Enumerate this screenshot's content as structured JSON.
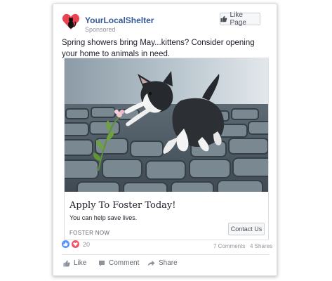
{
  "post": {
    "page_name": "YourLocalShelter",
    "sponsored_label": "Sponsored",
    "like_page_label": "Like Page",
    "text": "Spring showers bring May...kittens? Consider opening your home to animals in need."
  },
  "ad": {
    "image_subject": "kitten sniffing a flower on cobblestones",
    "headline": "Apply To Foster Today!",
    "description": "You can help save lives.",
    "caption": "FOSTER NOW",
    "cta_label": "Contact Us"
  },
  "engagement": {
    "reaction_count": "20",
    "comments": "7 Comments",
    "shares": "4 Shares"
  },
  "actions": {
    "like": "Like",
    "comment": "Comment",
    "share": "Share"
  },
  "colors": {
    "brand_link": "#365899",
    "like_blue": "#5890ff",
    "love_red": "#f25268",
    "logo_red": "#e8434e"
  },
  "icons": [
    "thumbs-up-icon",
    "heart-icon",
    "comment-icon",
    "share-icon",
    "cat-logo-icon"
  ]
}
